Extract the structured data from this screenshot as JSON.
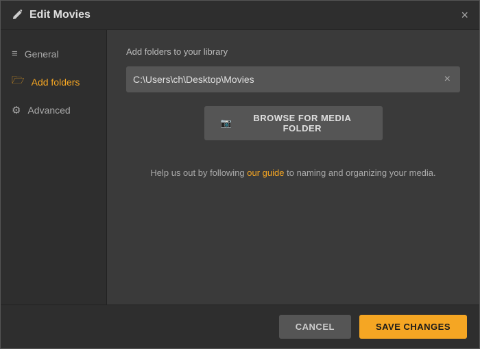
{
  "dialog": {
    "title": "Edit Movies",
    "close_label": "×"
  },
  "sidebar": {
    "items": [
      {
        "id": "general",
        "label": "General",
        "icon": "≡",
        "active": false
      },
      {
        "id": "add-folders",
        "label": "Add folders",
        "icon": "📁",
        "active": true
      },
      {
        "id": "advanced",
        "label": "Advanced",
        "icon": "⚙",
        "active": false
      }
    ]
  },
  "main": {
    "section_label": "Add folders to your library",
    "folder_path": "C:\\Users\\ch\\Desktop\\Movies",
    "browse_button_label": "BROWSE FOR MEDIA FOLDER",
    "guide_text_before": "Help us out by following ",
    "guide_link_text": "our guide",
    "guide_text_after": " to naming and organizing your media."
  },
  "footer": {
    "cancel_label": "CANCEL",
    "save_label": "SAVE CHANGES"
  },
  "colors": {
    "accent": "#f5a623"
  }
}
